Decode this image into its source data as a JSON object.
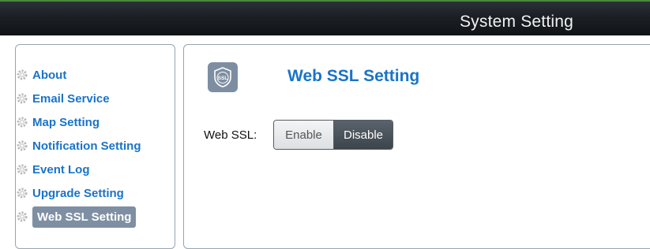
{
  "header": {
    "title": "System Setting"
  },
  "sidebar": {
    "items": [
      {
        "label": "About",
        "icon": "gear-icon"
      },
      {
        "label": "Email Service",
        "icon": "gear-icon"
      },
      {
        "label": "Map Setting",
        "icon": "gear-icon"
      },
      {
        "label": "Notification Setting",
        "icon": "gear-icon"
      },
      {
        "label": "Event Log",
        "icon": "gear-icon"
      },
      {
        "label": "Upgrade Setting",
        "icon": "gear-icon"
      },
      {
        "label": "Web SSL Setting",
        "icon": "gear-icon",
        "active": true
      }
    ]
  },
  "main": {
    "title": "Web SSL Setting",
    "icon": {
      "name": "ssl-shield-icon",
      "text": "SSL"
    },
    "web_ssl": {
      "label": "Web SSL:",
      "options": [
        "Enable",
        "Disable"
      ],
      "selected": "Disable"
    }
  },
  "colors": {
    "accent_text": "#1a73c8",
    "active_item_bg": "#7f8fa3",
    "header_bg": "#1b1f24",
    "toggle_selected": "#4a5259"
  }
}
